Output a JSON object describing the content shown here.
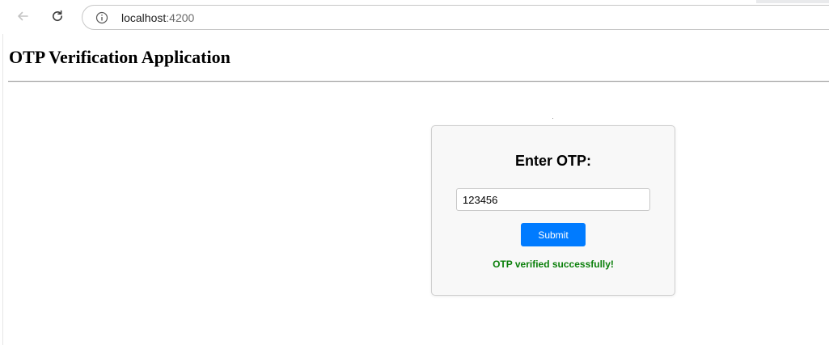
{
  "browser": {
    "url_host": "localhost",
    "url_port": ":4200",
    "icons": {
      "back": "arrow-left-icon",
      "reload": "reload-icon",
      "info": "info-icon"
    }
  },
  "page": {
    "app_title": "OTP Verification Application"
  },
  "otp_card": {
    "title": "Enter OTP:",
    "input_value": "123456",
    "submit_label": "Submit",
    "status_message": "OTP verified successfully!",
    "colors": {
      "button": "#007bff",
      "success": "#0a7f0a"
    }
  }
}
